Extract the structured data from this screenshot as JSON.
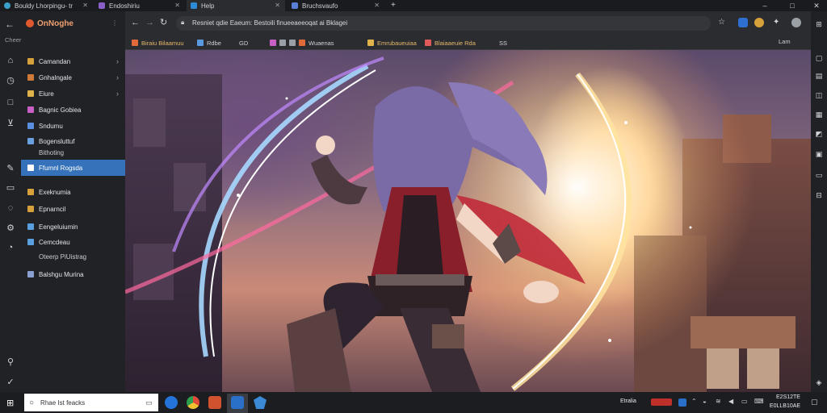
{
  "window": {
    "tabs": [
      {
        "label": "Bouldy Lhorpingu- tr",
        "icon": "globe-icon",
        "color": "#3aa0c8"
      },
      {
        "label": "Endoshiriu",
        "icon": "page-icon",
        "color": "#8a5fc7"
      },
      {
        "label": "Help",
        "icon": "help-icon",
        "color": "#2d8cd6"
      },
      {
        "label": "Bruchsvaufo",
        "icon": "page-icon",
        "color": "#5a7fd6"
      }
    ],
    "new_tab": "+",
    "controls": {
      "minimize": "–",
      "maximize": "□",
      "close": "✕"
    }
  },
  "sidebar": {
    "title": "OnNoghe",
    "caption": "Cheer",
    "items": [
      {
        "label": "Camandan",
        "color": "#d6a03a",
        "chevron": "›"
      },
      {
        "label": "Gnhalngale",
        "color": "#d07a3a",
        "chevron": "›"
      },
      {
        "label": "Eiure",
        "color": "#e0b34a",
        "chevron": "›"
      },
      {
        "label": "Bagnic Gobiea",
        "color": "#c85fc7",
        "chevron": ""
      },
      {
        "label": "Sndumu",
        "color": "#5a8fe0",
        "chevron": ""
      },
      {
        "label": "Bogensluttuf",
        "color": "#6aa0e0",
        "chevron": ""
      },
      {
        "label": "Ffumnl Rogsda",
        "color": "#ffffff",
        "chevron": "",
        "selected": true
      },
      {
        "label": "Exeknumia",
        "color": "#d6a03a",
        "chevron": ""
      },
      {
        "label": "Epnarncil",
        "color": "#d6a03a",
        "chevron": ""
      },
      {
        "label": "Eengeluiumin",
        "color": "#5aa0e0",
        "chevron": ""
      },
      {
        "label": "Cemcdeau",
        "color": "#5aa0e0",
        "chevron": ""
      },
      {
        "label": "Balshgu Murina",
        "color": "#8aa0d0",
        "chevron": ""
      }
    ],
    "subs": [
      "Bithoting",
      "Oteerp PiUistrag"
    ]
  },
  "toolbar": {
    "address": "Resniet qdie Eaeum: Bestoili finueeaeeoqat ai Bklagei",
    "zoom_label": "Lam"
  },
  "bookmarks": [
    {
      "label": "Biraiu Bilaamuu",
      "color": "#e06a3a",
      "warm": true
    },
    {
      "label": "Rdbe",
      "color": "#5a9ae0",
      "warm": false
    },
    {
      "label": "GD",
      "color": "#cccccc",
      "warm": false
    },
    {
      "label": "Wuaenas",
      "color": "#c85fc7",
      "warm": false
    },
    {
      "label": "Emrubaueuiaa",
      "color": "#e0b34a",
      "warm": true
    },
    {
      "label": "Blaiaaeuie Rda",
      "color": "#e05a5a",
      "warm": true
    },
    {
      "label": "SS",
      "color": "#cccccc",
      "warm": false
    }
  ],
  "taskbar": {
    "search_placeholder": "Rhae Ist feacks",
    "tray_text": "Etralia",
    "clock_time": "E2S12TE",
    "clock_date": "E0LLB10AE"
  }
}
